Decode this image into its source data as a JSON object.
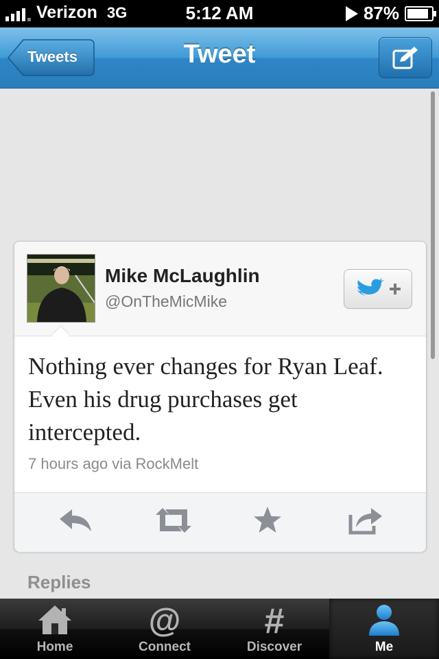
{
  "status_bar": {
    "carrier": "Verizon",
    "network": "3G",
    "time": "5:12 AM",
    "battery_text": "87%",
    "battery_level": 0.87
  },
  "nav": {
    "back_label": "Tweets",
    "title": "Tweet",
    "compose_icon": "compose-icon"
  },
  "tweet": {
    "user_name": "Mike McLaughlin",
    "handle": "@OnTheMicMike",
    "text": "Nothing ever changes for Ryan Leaf. Even his drug purchases get intercepted.",
    "meta": "7 hours ago via RockMelt",
    "follow_icon": "follow-bird-plus-icon",
    "actions": [
      "reply-icon",
      "retweet-icon",
      "favorite-icon",
      "share-icon"
    ]
  },
  "replies_label": "Replies",
  "tabs": [
    {
      "label": "Home",
      "icon": "home-icon",
      "active": false
    },
    {
      "label": "Connect",
      "icon": "at-icon",
      "active": false
    },
    {
      "label": "Discover",
      "icon": "hash-icon",
      "active": false
    },
    {
      "label": "Me",
      "icon": "person-icon",
      "active": true
    }
  ],
  "colors": {
    "nav_blue": "#3f9ad6",
    "twitter_bird": "#2a9de0",
    "action_icon": "#8c9096"
  }
}
